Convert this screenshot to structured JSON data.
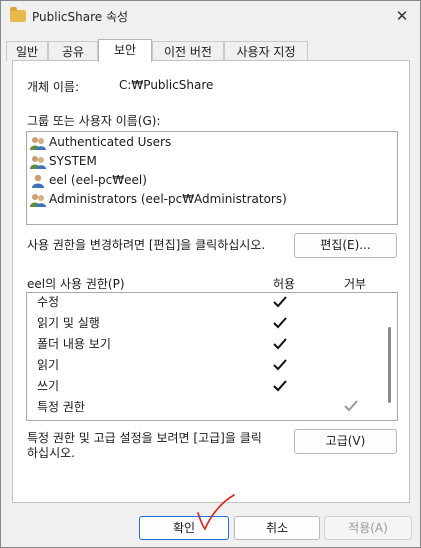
{
  "window": {
    "title": "PublicShare 속성",
    "close_glyph": "✕"
  },
  "tabs": [
    "일반",
    "공유",
    "보안",
    "이전 버전",
    "사용자 지정"
  ],
  "active_tab": "보안",
  "object": {
    "label": "개체 이름:",
    "value": "C:₩PublicShare"
  },
  "group_label": "그룹 또는 사용자 이름(G):",
  "users": [
    {
      "name": "Authenticated Users",
      "icon": "group-icon"
    },
    {
      "name": "SYSTEM",
      "icon": "group-icon"
    },
    {
      "name": "eel (eel-pc₩eel)",
      "icon": "user-icon"
    },
    {
      "name": "Administrators (eel-pc₩Administrators)",
      "icon": "group-icon"
    }
  ],
  "change_hint": "사용 권한을 변경하려면 [편집]을 클릭하십시오.",
  "edit_button": "편집(E)...",
  "perm_header": {
    "title": "eel의 사용 권한(P)",
    "allow": "허용",
    "deny": "거부"
  },
  "permissions": [
    {
      "name": "수정",
      "allow": true,
      "deny": false
    },
    {
      "name": "읽기 및 실행",
      "allow": true,
      "deny": false
    },
    {
      "name": "폴더 내용 보기",
      "allow": true,
      "deny": false
    },
    {
      "name": "읽기",
      "allow": true,
      "deny": false
    },
    {
      "name": "쓰기",
      "allow": true,
      "deny": false
    },
    {
      "name": "특정 권한",
      "allow": false,
      "deny": "dimmed"
    }
  ],
  "advanced_hint_line1": "특정 권한 및 고급 설정을 보려면 [고급]을 클릭",
  "advanced_hint_line2": "하십시오.",
  "advanced_button": "고급(V)",
  "footer": {
    "ok": "확인",
    "cancel": "취소",
    "apply": "적용(A)"
  },
  "colors": {
    "accent": "#2b6fd1",
    "annotation": "#e0201a",
    "check": "#111111",
    "check_dimmed": "#9a9a9a"
  }
}
